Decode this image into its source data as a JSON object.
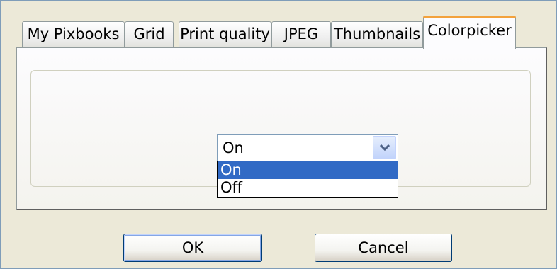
{
  "tabs": [
    {
      "label": "My Pixbooks"
    },
    {
      "label": "Grid"
    },
    {
      "label": "Print quality"
    },
    {
      "label": "JPEG"
    },
    {
      "label": "Thumbnails"
    },
    {
      "label": "Colorpicker",
      "active": true
    }
  ],
  "colorpicker": {
    "combo_value": "On",
    "options": [
      {
        "label": "On",
        "selected": true
      },
      {
        "label": "Off"
      }
    ]
  },
  "buttons": {
    "ok_label": "OK",
    "cancel_label": "Cancel"
  },
  "colors": {
    "selection": "#316ac5",
    "active_tab_accent": "#f3a23c",
    "dialog_background": "#ece9d8"
  },
  "icons": {
    "combo_arrow": "chevron-down-icon"
  }
}
